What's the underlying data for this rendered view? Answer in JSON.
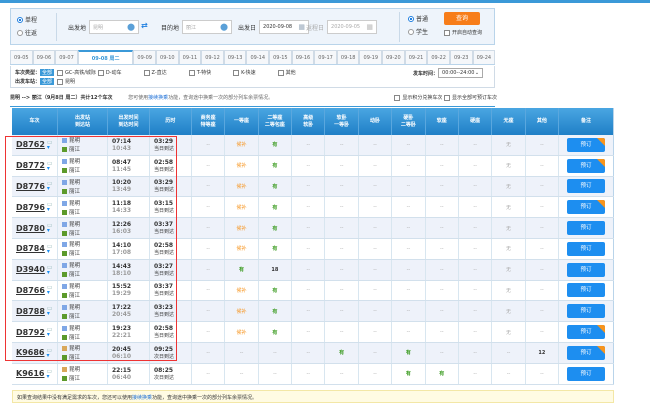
{
  "search": {
    "trip_types": [
      "单程",
      "往返"
    ],
    "from_label": "出发地",
    "from_value": "昆明",
    "to_label": "目的地",
    "to_value": "丽江",
    "depart_label": "出发日",
    "depart_value": "2020-09-08",
    "return_label": "返程日",
    "return_value": "2020-09-05",
    "passenger_types": [
      "普通",
      "学生"
    ],
    "query_label": "查询",
    "auto_query_label": "开启自动查询"
  },
  "dates": [
    "09-05",
    "09-06",
    "09-07",
    "09-08 周二",
    "09-09",
    "09-10",
    "09-11",
    "09-12",
    "09-13",
    "09-14",
    "09-15",
    "09-16",
    "09-17",
    "09-18",
    "09-19",
    "09-20",
    "09-21",
    "09-22",
    "09-23",
    "09-24"
  ],
  "filters": {
    "type_label": "车次类型：",
    "all": "全部",
    "types": [
      "GC-高铁/城际",
      "D-动车",
      "Z-直达",
      "T-特快",
      "K-快速",
      "其他"
    ],
    "station_label": "出发车站：",
    "stations": [
      "昆明"
    ],
    "time_label": "发车时间：",
    "time_value": "00:00--24:00"
  },
  "summary": {
    "route": "昆明 --> 丽江（9月8日 周二）共计12个车次",
    "hint_pre": "您可使用",
    "hint_link": "接续换乘",
    "hint_post": "功能，查询途中换乘一次的部分列车余票情况。",
    "opt1": "显示积分兑换车次",
    "opt2": "显示全部可预订车次"
  },
  "columns": [
    "车次",
    "出发站\n到达站",
    "出发时间\n到达时间",
    "历时",
    "商务座\n特等座",
    "一等座",
    "二等座\n二等包座",
    "高级\n软卧",
    "软卧\n一等卧",
    "动卧",
    "硬卧\n二等卧",
    "软座",
    "硬座",
    "无座",
    "其他",
    "备注"
  ],
  "book_label": "预订",
  "trains": [
    {
      "no": "D8762",
      "from": "昆明",
      "to": "丽江",
      "dep": "07:14",
      "arr": "10:43",
      "dur": "03:29",
      "day": "当日到达",
      "seats": [
        "--",
        "候补",
        "有",
        "--",
        "--",
        "--",
        "--",
        "--",
        "--",
        "无",
        "--"
      ],
      "badge": true
    },
    {
      "no": "D8772",
      "from": "昆明",
      "to": "丽江",
      "dep": "08:47",
      "arr": "11:45",
      "dur": "02:58",
      "day": "当日到达",
      "seats": [
        "--",
        "候补",
        "有",
        "--",
        "--",
        "--",
        "--",
        "--",
        "--",
        "无",
        "--"
      ],
      "badge": true
    },
    {
      "no": "D8776",
      "from": "昆明",
      "to": "丽江",
      "dep": "10:20",
      "arr": "13:49",
      "dur": "03:29",
      "day": "当日到达",
      "seats": [
        "--",
        "候补",
        "有",
        "--",
        "--",
        "--",
        "--",
        "--",
        "--",
        "无",
        "--"
      ],
      "badge": false
    },
    {
      "no": "D8796",
      "from": "昆明",
      "to": "丽江",
      "dep": "11:18",
      "arr": "14:33",
      "dur": "03:15",
      "day": "当日到达",
      "seats": [
        "--",
        "候补",
        "有",
        "--",
        "--",
        "--",
        "--",
        "--",
        "--",
        "无",
        "--"
      ],
      "badge": true
    },
    {
      "no": "D8780",
      "from": "昆明",
      "to": "丽江",
      "dep": "12:26",
      "arr": "16:03",
      "dur": "03:37",
      "day": "当日到达",
      "seats": [
        "--",
        "候补",
        "有",
        "--",
        "--",
        "--",
        "--",
        "--",
        "--",
        "无",
        "--"
      ],
      "badge": false
    },
    {
      "no": "D8784",
      "from": "昆明",
      "to": "丽江",
      "dep": "14:10",
      "arr": "17:08",
      "dur": "02:58",
      "day": "当日到达",
      "seats": [
        "--",
        "候补",
        "有",
        "--",
        "--",
        "--",
        "--",
        "--",
        "--",
        "无",
        "--"
      ],
      "badge": false
    },
    {
      "no": "D3940",
      "from": "昆明",
      "to": "丽江",
      "dep": "14:43",
      "arr": "18:10",
      "dur": "03:27",
      "day": "当日到达",
      "seats": [
        "--",
        "有",
        "18",
        "--",
        "--",
        "--",
        "--",
        "--",
        "--",
        "无",
        "--"
      ],
      "badge": false
    },
    {
      "no": "D8766",
      "from": "昆明",
      "to": "丽江",
      "dep": "15:52",
      "arr": "19:29",
      "dur": "03:37",
      "day": "当日到达",
      "seats": [
        "--",
        "候补",
        "有",
        "--",
        "--",
        "--",
        "--",
        "--",
        "--",
        "无",
        "--"
      ],
      "badge": false
    },
    {
      "no": "D8788",
      "from": "昆明",
      "to": "丽江",
      "dep": "17:22",
      "arr": "20:45",
      "dur": "03:23",
      "day": "当日到达",
      "seats": [
        "--",
        "候补",
        "有",
        "--",
        "--",
        "--",
        "--",
        "--",
        "--",
        "无",
        "--"
      ],
      "badge": false
    },
    {
      "no": "D8792",
      "from": "昆明",
      "to": "丽江",
      "dep": "19:23",
      "arr": "22:21",
      "dur": "02:58",
      "day": "当日到达",
      "seats": [
        "--",
        "候补",
        "有",
        "--",
        "--",
        "--",
        "--",
        "--",
        "--",
        "无",
        "--"
      ],
      "badge": true
    },
    {
      "no": "K9686",
      "from": "昆明",
      "to": "丽江",
      "dep": "20:45",
      "arr": "06:10",
      "dur": "09:25",
      "day": "次日到达",
      "seats": [
        "--",
        "--",
        "--",
        "--",
        "有",
        "--",
        "有",
        "--",
        "--",
        "--",
        "12"
      ],
      "badge": true
    },
    {
      "no": "K9616",
      "from": "昆明",
      "to": "丽江",
      "dep": "22:15",
      "arr": "06:40",
      "dur": "08:25",
      "day": "次日到达",
      "seats": [
        "--",
        "--",
        "--",
        "--",
        "--",
        "--",
        "有",
        "有",
        "--",
        "--",
        "--"
      ],
      "badge": false
    }
  ],
  "footer": {
    "pre": "如果查询结果中没有满足需求的车次，您还可以使用",
    "link": "接续换乘",
    "post": "功能，查询途中换乘一次的部分列车余票情况。"
  },
  "colors": {
    "accent": "#3b99d8",
    "query": "#f77d1a",
    "book": "#1d8ef0",
    "available": "#3a9b1f",
    "waitlist": "#f7941d"
  }
}
